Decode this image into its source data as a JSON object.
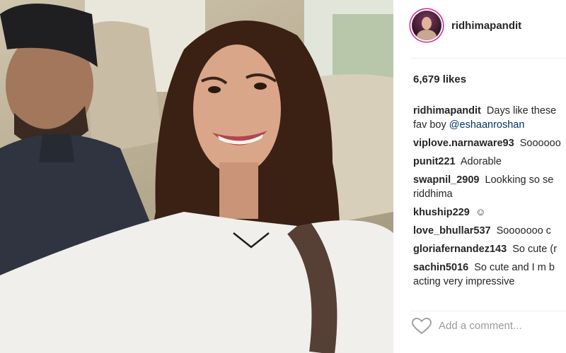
{
  "post": {
    "username": "ridhimapandit",
    "likes": "6,679 likes"
  },
  "comments": [
    {
      "user": "ridhimapandit",
      "text": "Days like these",
      "line2_pre": "fav boy ",
      "mention": "@eshaanroshan"
    },
    {
      "user": "viplove.narnaware93",
      "text": "Soooooo"
    },
    {
      "user": "punit221",
      "text": "Adorable"
    },
    {
      "user": "swapnil_2909",
      "text": "Lookking so se",
      "line2": "riddhima"
    },
    {
      "user": "khuship229",
      "text": "☺"
    },
    {
      "user": "love_bhullar537",
      "text": "Sooooooo c"
    },
    {
      "user": "gloriafernandez143",
      "text": "So cute (r"
    },
    {
      "user": "sachin5016",
      "text": "So cute and I m b",
      "line2": "acting very impressive"
    }
  ],
  "add_comment": {
    "placeholder": "Add a comment..."
  },
  "icons": {
    "like": "heart-outline-icon"
  },
  "colors": {
    "avatar_ring": "#d6249f",
    "mention": "#003569",
    "placeholder": "#999999"
  }
}
